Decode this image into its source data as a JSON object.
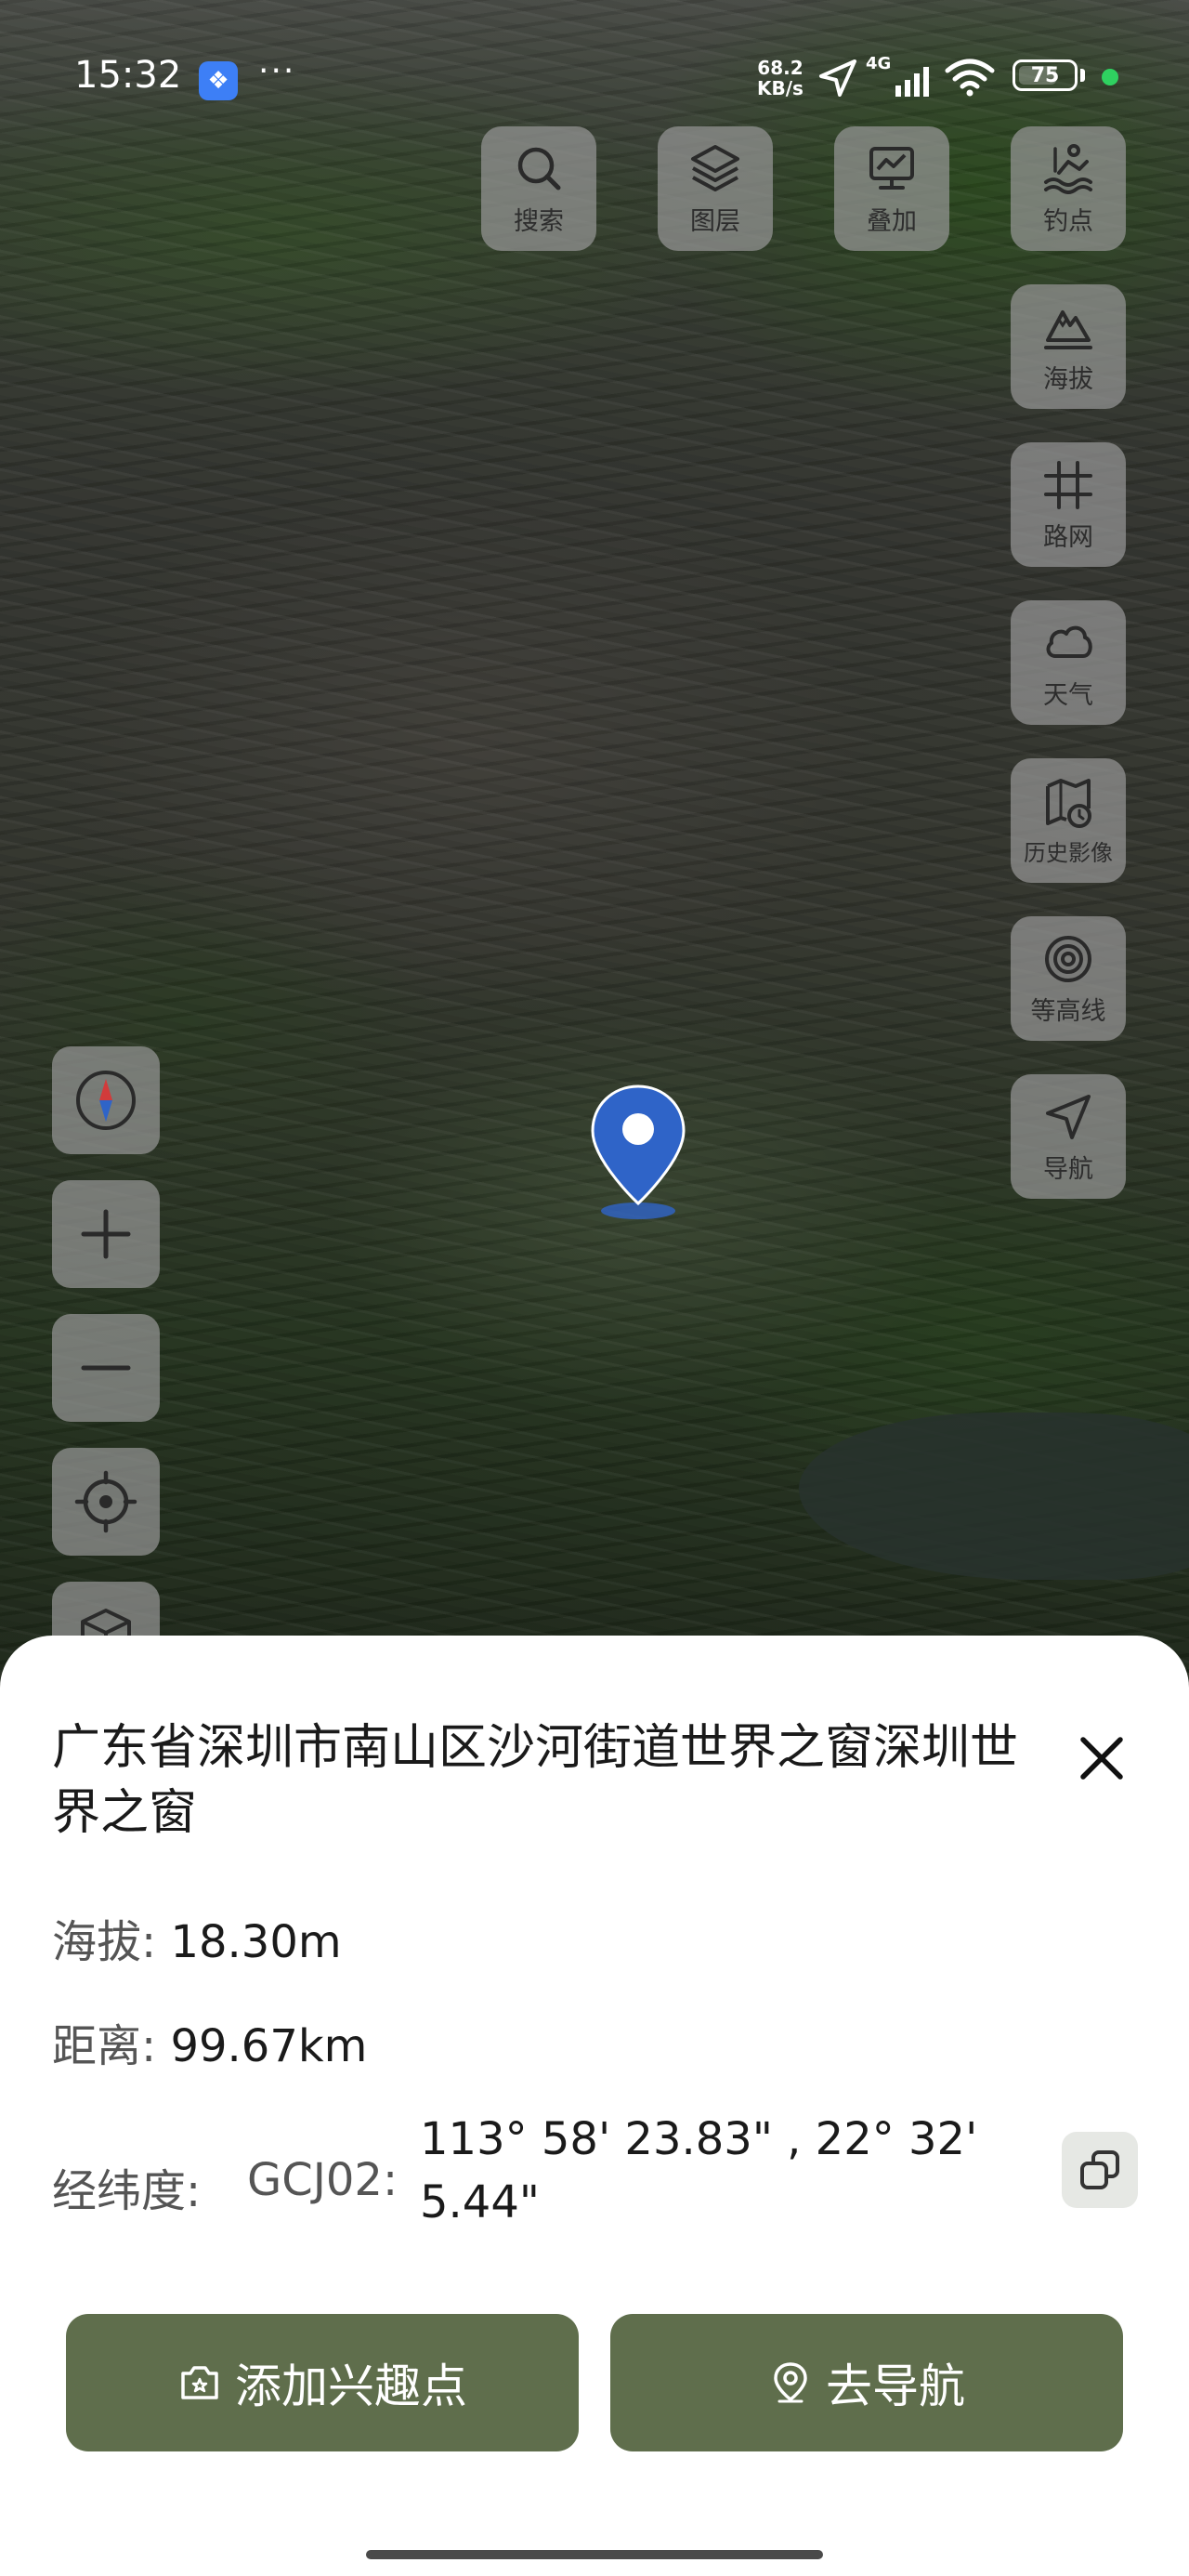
{
  "status_bar": {
    "time": "15:32",
    "more": "···",
    "net_speed_value": "68.2",
    "net_speed_unit": "KB/s",
    "network": "4G",
    "battery": "75"
  },
  "map_tools": {
    "search": "搜索",
    "layers": "图层",
    "overlay": "叠加",
    "fishing": "钓点",
    "elevation": "海拔",
    "road_grid": "路网",
    "weather": "天气",
    "history": "历史影像",
    "contour": "等高线",
    "navigation": "导航"
  },
  "location": {
    "address": "广东省深圳市南山区沙河街道世界之窗深圳世界之窗",
    "altitude_label": "海拔:",
    "altitude_value": "18.30m",
    "distance_label": "距离:",
    "distance_value": "99.67km",
    "coords_label": "经纬度:",
    "coord_system": "GCJ02:",
    "coords_value": "113° 58' 23.83\" , 22° 32' 5.44\""
  },
  "actions": {
    "add_poi": "添加兴趣点",
    "go_navigate": "去导航"
  },
  "colors": {
    "primary_button": "#5f6e4c",
    "marker": "#2f64c8"
  }
}
